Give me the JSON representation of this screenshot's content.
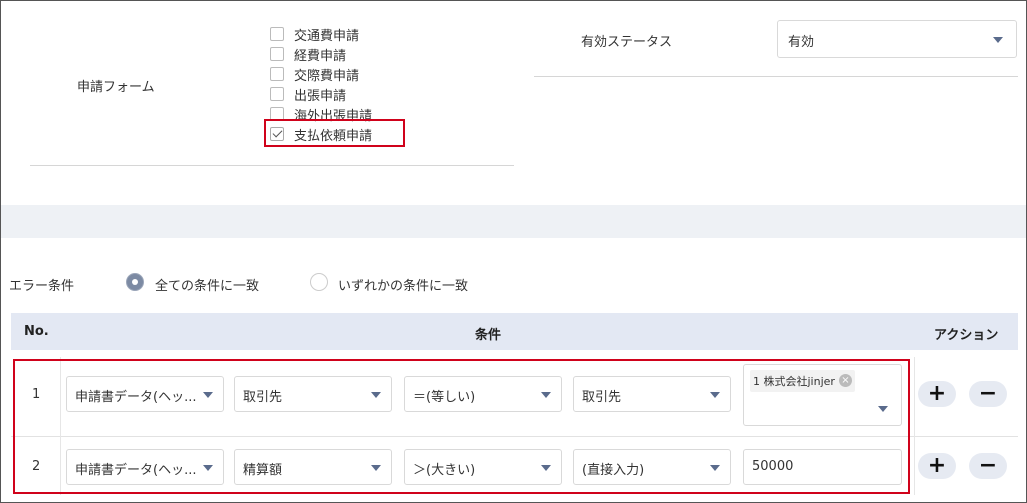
{
  "form_section": {
    "label": "申請フォーム",
    "checkboxes": [
      {
        "label": "交通費申請",
        "checked": false
      },
      {
        "label": "経費申請",
        "checked": false
      },
      {
        "label": "交際費申請",
        "checked": false
      },
      {
        "label": "出張申請",
        "checked": false
      },
      {
        "label": "海外出張申請",
        "checked": false
      },
      {
        "label": "支払依頼申請",
        "checked": true
      }
    ]
  },
  "status_section": {
    "label": "有効ステータス",
    "value": "有効"
  },
  "error_condition": {
    "label": "エラー条件",
    "options": [
      {
        "label": "全ての条件に一致",
        "selected": true
      },
      {
        "label": "いずれかの条件に一致",
        "selected": false
      }
    ]
  },
  "table": {
    "headers": {
      "no": "No.",
      "condition": "条件",
      "action": "アクション"
    },
    "rows": [
      {
        "no": "1",
        "source": "申請書データ(ヘッ...",
        "field": "取引先",
        "operator": "＝(等しい)",
        "value_type": "取引先",
        "value_tag": "1 株式会社jinjer"
      },
      {
        "no": "2",
        "source": "申請書データ(ヘッ...",
        "field": "精算額",
        "operator": "＞(大きい)",
        "value_type": "(直接入力)",
        "value_input": "50000"
      }
    ],
    "actions": {
      "add": "+",
      "remove": "−"
    }
  },
  "colors": {
    "highlight": "#d0021b",
    "table_header_bg": "#e3e8f3",
    "band_bg": "#eef1f5",
    "caret": "#5a6b8c",
    "radio_on": "#7c8aa3"
  }
}
